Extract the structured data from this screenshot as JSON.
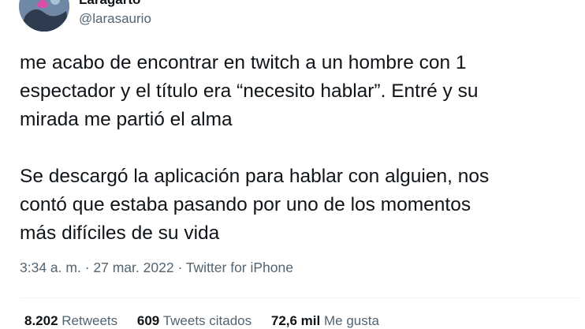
{
  "author": {
    "display_name": "Laragarto",
    "handle": "@larasaurio"
  },
  "tweet": {
    "paragraphs": [
      [
        "me acabo de encontrar en twitch a un hombre con 1",
        "espectador y el título era “necesito hablar”. Entré y su",
        "mirada me partió el alma"
      ],
      [
        "Se descargó la aplicación para hablar con alguien, nos",
        "contó que estaba pasando por uno de los momentos",
        "más difíciles de su vida"
      ]
    ],
    "time": "3:34 a. m.",
    "separator": "·",
    "date": "27 mar. 2022",
    "source": "Twitter for iPhone"
  },
  "stats": {
    "retweets_count": "8.202",
    "retweets_label": "Retweets",
    "quotes_count": "609",
    "quotes_label": "Tweets citados",
    "likes_count": "72,6 mil",
    "likes_label": "Me gusta"
  },
  "colors": {
    "text_primary": "#0f1419",
    "text_secondary": "#536471",
    "divider": "#eff3f4"
  },
  "icons": {
    "more": "more-dots-icon"
  }
}
